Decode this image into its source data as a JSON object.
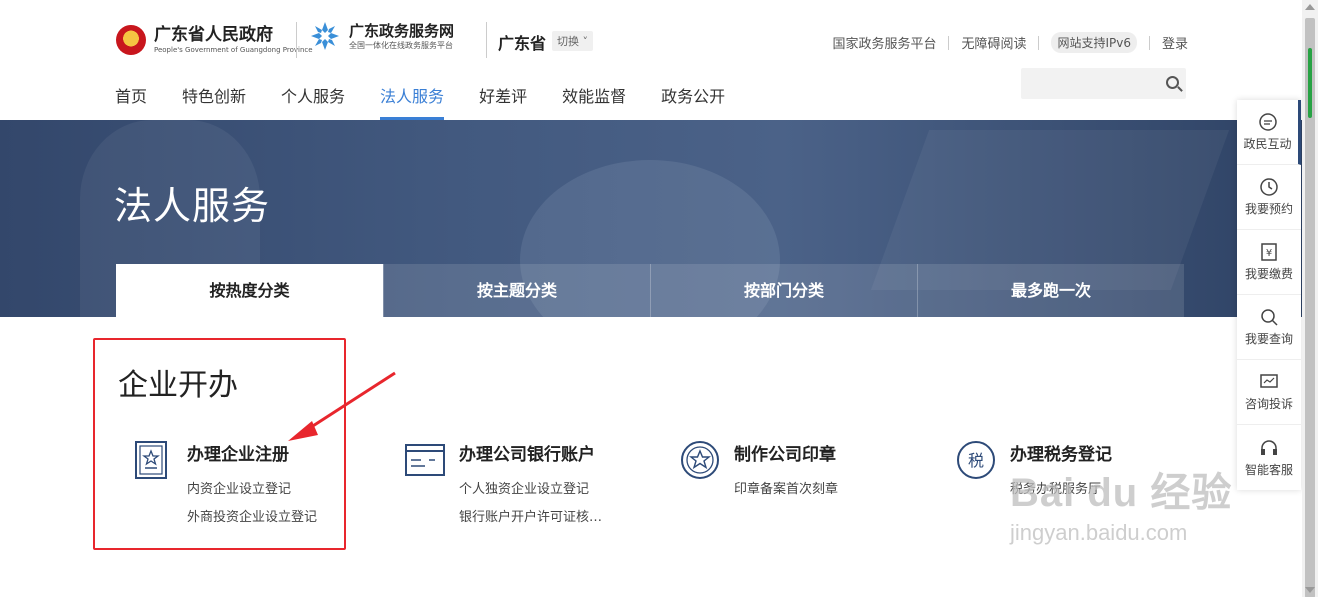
{
  "header": {
    "logo1_main": "广东省人民政府",
    "logo1_sub": "People's Government of Guangdong Province",
    "logo2_main": "广东政务服务网",
    "logo2_sub": "全国一体化在线政务服务平台",
    "region": "广东省",
    "switch_label": "切换",
    "toplinks": [
      "国家政务服务平台",
      "无障碍阅读",
      "网站支持IPv6",
      "登录"
    ],
    "search_placeholder": ""
  },
  "nav": {
    "items": [
      "首页",
      "特色创新",
      "个人服务",
      "法人服务",
      "好差评",
      "效能监督",
      "政务公开"
    ],
    "active_index": 3
  },
  "banner": {
    "title": "法人服务",
    "tabs": [
      "按热度分类",
      "按主题分类",
      "按部门分类",
      "最多跑一次"
    ],
    "active_tab": 0
  },
  "section": {
    "title": "企业开办",
    "cards": [
      {
        "icon": "certificate-icon",
        "title": "办理企业注册",
        "subs": [
          "内资企业设立登记",
          "外商投资企业设立登记"
        ]
      },
      {
        "icon": "bank-card-icon",
        "title": "办理公司银行账户",
        "subs": [
          "个人独资企业设立登记",
          "银行账户开户许可证核…"
        ]
      },
      {
        "icon": "seal-icon",
        "title": "制作公司印章",
        "subs": [
          "印章备案首次刻章"
        ]
      },
      {
        "icon": "tax-icon",
        "title": "办理税务登记",
        "subs": [
          "税务办税服务厅"
        ]
      }
    ]
  },
  "sidebar": {
    "items": [
      "政民互动",
      "我要预约",
      "我要缴费",
      "我要查询",
      "咨询投诉",
      "智能客服"
    ]
  },
  "watermark": {
    "main": "Bai du 经验",
    "sub": "jingyan.baidu.com"
  },
  "colors": {
    "accent": "#3a7fd5",
    "highlight_box": "#e8262d",
    "banner": "#3a5078"
  }
}
